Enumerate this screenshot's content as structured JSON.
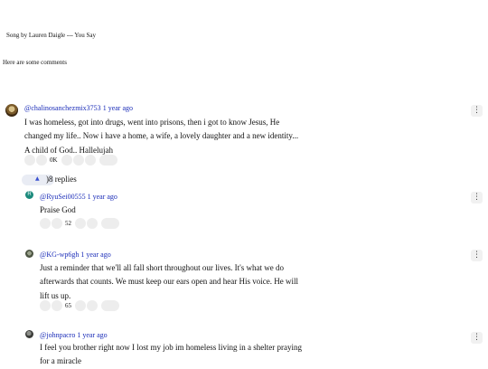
{
  "header": {
    "song_title": "Song by Lauren Daigle --- You Say",
    "intro": "Here are some comments"
  },
  "top_comment": {
    "author": "@chalinosanchezmix3753",
    "time": "1 year ago",
    "lines": [
      "I was homeless, got into drugs, went into prisons, then i got to know Jesus, He",
      "changed my life.. Now i have a home, a wife, a lovely daughter and a new identity...",
      "A child of God.. Hallelujah"
    ],
    "likes": "0K",
    "replies_label": ")8 replies",
    "more_icon": "⋮"
  },
  "replies": [
    {
      "author": "@RyuSei00555",
      "time": "1 year ago",
      "avatar_letter": "R",
      "avatar_color": "#1b8a7c",
      "lines": [
        "Praise God"
      ],
      "likes": "52"
    },
    {
      "author": "@KG-wp6gh",
      "time": "1 year ago",
      "lines": [
        "Just a reminder that we'll all fall short throughout our lives. It's what we do",
        "afterwards that counts. We must keep our ears open and hear His voice. He will",
        "lift us up."
      ],
      "likes": "65"
    },
    {
      "author": "@johnpacro",
      "time": "1 year ago",
      "lines": [
        "I feel you brother right now I lost my job im homeless living in a shelter praying",
        "for a miracle"
      ]
    }
  ],
  "colors": {
    "link": "#1a2cb8",
    "pill": "#ededed"
  }
}
